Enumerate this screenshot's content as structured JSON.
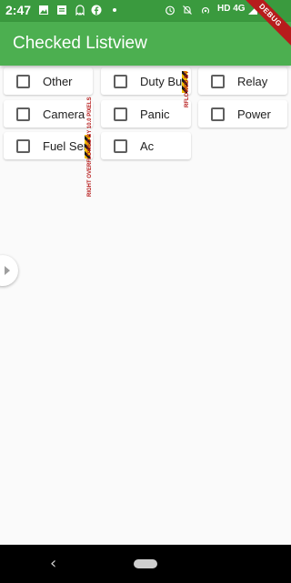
{
  "status_bar": {
    "time": "2:47",
    "right_text": "HD 4G"
  },
  "app_bar": {
    "title": "Checked Listview"
  },
  "debug_banner": "DEBUG",
  "items": [
    {
      "label": "Other",
      "checked": false
    },
    {
      "label": "Duty But",
      "checked": false
    },
    {
      "label": "Relay",
      "checked": false
    },
    {
      "label": "Camera",
      "checked": false
    },
    {
      "label": "Panic",
      "checked": false
    },
    {
      "label": "Power",
      "checked": false
    },
    {
      "label": "Fuel Sen",
      "checked": false
    },
    {
      "label": "Ac",
      "checked": false
    }
  ],
  "overflow_warnings": {
    "col1": "RIGHT OVERFLOWED BY 10.0 PIXELS",
    "col2": "RFLOWED BY"
  },
  "icons": {
    "status_left": [
      "photo-icon",
      "message-icon",
      "ghost-icon",
      "facebook-icon",
      "dot-icon"
    ],
    "status_right": [
      "alarm-icon",
      "mute-icon",
      "hotspot-icon",
      "signal-icon",
      "battery-icon"
    ],
    "side_handle": "chevron-right-icon",
    "nav_back": "back-icon",
    "nav_home": "home-pill-icon"
  },
  "colors": {
    "app_bar": "#4caf50",
    "status_bar": "#3a9a3e",
    "debug_banner": "#b71c1c",
    "background": "#fafafa"
  }
}
